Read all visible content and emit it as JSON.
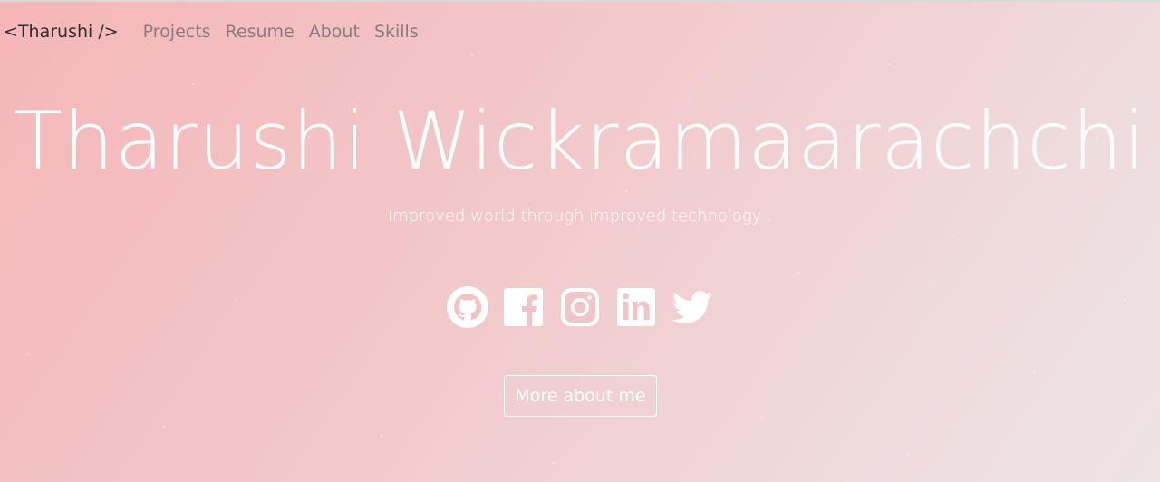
{
  "nav": {
    "brand": "<Tharushi />",
    "links": [
      "Projects",
      "Resume",
      "About",
      "Skills"
    ]
  },
  "hero": {
    "name": "Tharushi Wickramaarachchi",
    "tagline": "improved world through improved technology ."
  },
  "socials": [
    {
      "icon": "github-icon"
    },
    {
      "icon": "facebook-icon"
    },
    {
      "icon": "instagram-icon"
    },
    {
      "icon": "linkedin-icon"
    },
    {
      "icon": "twitter-icon"
    }
  ],
  "cta": {
    "label": "More about me"
  },
  "colors": {
    "gradient_start": "#f5b6b8",
    "gradient_end": "#ede3e4",
    "text_light": "#ffffff",
    "nav_link": "#8c7b7d",
    "brand": "#2e2e2e"
  }
}
